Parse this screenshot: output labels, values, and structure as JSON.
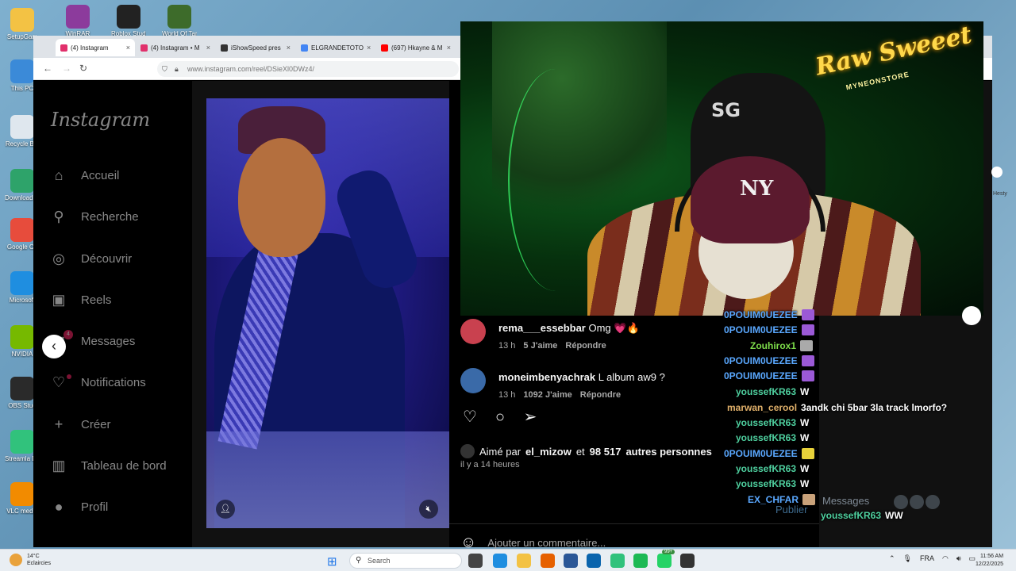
{
  "desktop": {
    "icons": [
      {
        "label": "SetupGam",
        "color": "#f3c244"
      },
      {
        "label": "This PC",
        "color": "#3b8ad8"
      },
      {
        "label": "Recycle Bin",
        "color": "#dfe7ee"
      },
      {
        "label": "Download Shortcu",
        "color": "#2ea36a"
      },
      {
        "label": "Google Ch",
        "color": "#e74c3c"
      },
      {
        "label": "Microsoft",
        "color": "#1f8ee0"
      },
      {
        "label": "NVIDIA",
        "color": "#76b900"
      },
      {
        "label": "OBS Stud",
        "color": "#2a2a2a"
      },
      {
        "label": "Streamla Deskto",
        "color": "#31c27c"
      },
      {
        "label": "VLC media",
        "color": "#f28b00"
      }
    ],
    "top_icons": [
      {
        "label": "WinRAR",
        "color": "#8c3b9c"
      },
      {
        "label": "Roblox Studio",
        "color": "#222222"
      },
      {
        "label": "World Of Tank",
        "color": "#3d6b2a"
      }
    ]
  },
  "browser": {
    "tabs": [
      {
        "label": "(4) Instagram",
        "favicon": "#e1306c",
        "active": true
      },
      {
        "label": "(4) Instagram • M",
        "favicon": "#e1306c",
        "active": false
      },
      {
        "label": "iShowSpeed pres",
        "favicon": "#333333",
        "active": false
      },
      {
        "label": "ELGRANDETOTO",
        "favicon": "#4285f4",
        "active": false
      },
      {
        "label": "(697) Hkayne & M",
        "favicon": "#ff0000",
        "active": false
      }
    ],
    "url": "www.instagram.com/reel/DSieXl0DWz4/"
  },
  "instagram": {
    "logo": "Instagram",
    "nav": [
      {
        "label": "Accueil",
        "icon": "home-icon",
        "glyph": "⌂"
      },
      {
        "label": "Recherche",
        "icon": "search-icon",
        "glyph": "⚲"
      },
      {
        "label": "Découvrir",
        "icon": "compass-icon",
        "glyph": "◎"
      },
      {
        "label": "Reels",
        "icon": "reels-icon",
        "glyph": "▣"
      },
      {
        "label": "Messages",
        "icon": "messenger-icon",
        "glyph": "✉",
        "badge": "4"
      },
      {
        "label": "Notifications",
        "icon": "heart-icon",
        "glyph": "♡",
        "dot": true
      },
      {
        "label": "Créer",
        "icon": "plus-icon",
        "glyph": "+"
      },
      {
        "label": "Tableau de bord",
        "icon": "dashboard-icon",
        "glyph": "▥"
      },
      {
        "label": "Profil",
        "icon": "profile-avatar-icon",
        "glyph": "●"
      }
    ],
    "comments": [
      {
        "user": "rema___essebbar",
        "text": "Omg 💗🔥",
        "time": "13 h",
        "likes": "5 J'aime",
        "reply": "Répondre",
        "avatar": "#c9414f"
      },
      {
        "user": "moneimbenyachrak",
        "text": "L album aw9 ?",
        "time": "13 h",
        "likes": "1092 J'aime",
        "reply": "Répondre",
        "avatar": "#3a6aa8"
      }
    ],
    "likes_prefix": "Aimé par",
    "likes_user": "el_mizow",
    "likes_mid": "et",
    "likes_count": "98 517",
    "likes_suffix": "autres personnes",
    "time_ago": "il y a 14 heures",
    "add_comment_placeholder": "Ajouter un commentaire...",
    "publish": "Publier",
    "messages_tray": "Messages"
  },
  "stream": {
    "sign": "Raw Sweeet",
    "sign_sub": "MYNEONSTORE",
    "chair_logo": "SG",
    "cap_logo": "NY"
  },
  "chat": [
    {
      "user": "0POUIM0UEZEE",
      "msg": "",
      "color": "#5aa8ff",
      "emote": "#9b59d6"
    },
    {
      "user": "0POUIM0UEZEE",
      "msg": "",
      "color": "#5aa8ff",
      "emote": "#9b59d6"
    },
    {
      "user": "Zouhirox1",
      "msg": "",
      "color": "#7ddc4a",
      "emote": "#aaaaaa"
    },
    {
      "user": "0POUIM0UEZEE",
      "msg": "",
      "color": "#5aa8ff",
      "emote": "#9b59d6"
    },
    {
      "user": "0POUIM0UEZEE",
      "msg": "",
      "color": "#5aa8ff",
      "emote": "#9b59d6"
    },
    {
      "user": "youssefKR63",
      "msg": "W",
      "color": "#4fd1a0",
      "emote": ""
    },
    {
      "user": "marwan_cerool",
      "msg": "3andk chi 5bar 3la track lmorfo?",
      "color": "#e0b06a",
      "emote": ""
    },
    {
      "user": "youssefKR63",
      "msg": "W",
      "color": "#4fd1a0",
      "emote": ""
    },
    {
      "user": "youssefKR63",
      "msg": "W",
      "color": "#4fd1a0",
      "emote": ""
    },
    {
      "user": "0POUIM0UEZEE",
      "msg": "",
      "color": "#5aa8ff",
      "emote": "#e8d23a"
    },
    {
      "user": "youssefKR63",
      "msg": "W",
      "color": "#4fd1a0",
      "emote": ""
    },
    {
      "user": "youssefKR63",
      "msg": "W",
      "color": "#4fd1a0",
      "emote": ""
    },
    {
      "user": "EX_CHFAR",
      "msg": "",
      "color": "#5aa8ff",
      "emote": "#c9a27a"
    },
    {
      "user": "youssefKR63",
      "msg": "WW",
      "color": "#4fd1a0",
      "emote": ""
    }
  ],
  "taskbar": {
    "weather_temp": "14°C",
    "weather_desc": "Eclaircies",
    "search_placeholder": "Search",
    "apps": [
      {
        "icon": "file-explorer-icon",
        "color": "#444444"
      },
      {
        "icon": "edge-icon",
        "color": "#1f8ee0"
      },
      {
        "icon": "folder-icon",
        "color": "#f3c244"
      },
      {
        "icon": "firefox-icon",
        "color": "#e66000"
      },
      {
        "icon": "store-icon",
        "color": "#2b5797"
      },
      {
        "icon": "mail-icon",
        "color": "#0a64ad"
      },
      {
        "icon": "streamlabs-icon",
        "color": "#31c27c"
      },
      {
        "icon": "spotify-icon",
        "color": "#1db954"
      },
      {
        "icon": "whatsapp-icon",
        "color": "#25d366"
      },
      {
        "icon": "chatgpt-icon",
        "color": "#333333"
      }
    ],
    "whatsapp_badge": "99+",
    "lang": "FRA",
    "time": "11:56 AM",
    "date": "12/22/2025",
    "side_label": "Hesty"
  }
}
